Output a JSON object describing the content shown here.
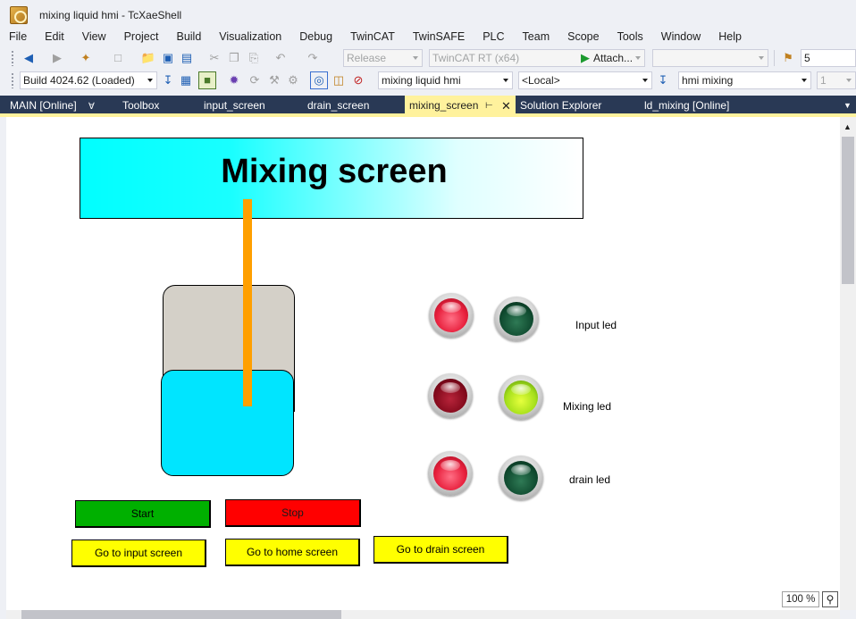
{
  "window": {
    "title": "mixing liquid hmi - TcXaeShell"
  },
  "menu": [
    "File",
    "Edit",
    "View",
    "Project",
    "Build",
    "Visualization",
    "Debug",
    "TwinCAT",
    "TwinSAFE",
    "PLC",
    "Team",
    "Scope",
    "Tools",
    "Window",
    "Help"
  ],
  "toolbar1": {
    "configuration": "Release",
    "platform": "TwinCAT RT (x64)",
    "attach_label": "Attach...",
    "right_value": "5"
  },
  "toolbar2": {
    "build": "Build 4024.62 (Loaded)",
    "project": "mixing liquid hmi",
    "target": "<Local>",
    "visualization": "hmi mixing",
    "right_value": "1"
  },
  "tabs": [
    {
      "label": "MAIN [Online]",
      "pinned": true
    },
    {
      "label": "Toolbox"
    },
    {
      "label": "input_screen"
    },
    {
      "label": "drain_screen"
    },
    {
      "label": "mixing_screen",
      "active": true
    },
    {
      "label": "Solution Explorer"
    },
    {
      "label": "ld_mixing [Online]"
    }
  ],
  "hmi": {
    "header_title": "Mixing screen",
    "leds": [
      {
        "label": "Input led",
        "red": "on",
        "green": "off"
      },
      {
        "label": "Mixing led",
        "red": "off",
        "green": "on"
      },
      {
        "label": "drain led",
        "red": "on",
        "green": "off"
      }
    ],
    "buttons": {
      "start": "Start",
      "stop": "Stop",
      "go_input": "Go to input screen",
      "go_home": "Go to home screen",
      "go_drain": "Go to drain screen"
    },
    "colors": {
      "header": "#00ffff",
      "liquid": "#00e5ff",
      "tank_empty": "#d4d0c8",
      "stirrer": "#ff9f00",
      "start": "#00b000",
      "stop": "#ff0000",
      "nav": "#ffff00"
    }
  },
  "status": {
    "zoom": "100 %"
  }
}
